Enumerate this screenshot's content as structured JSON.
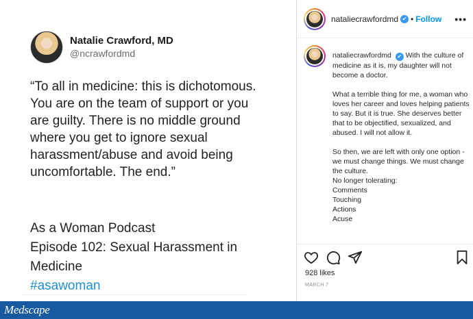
{
  "tweet_card": {
    "author_name": "Natalie Crawford, MD",
    "author_handle": "@ncrawfordmd",
    "quote": "“To all in medicine: this is dichotomous. You are on the team of support or you are guilty. There is no middle ground where you get to ignore sexual harassment/abuse and avoid being uncomfortable. The end.”",
    "podcast_line1": "As a Woman Podcast",
    "podcast_line2": "Episode 102: Sexual Harassment in Medicine",
    "hashtag": "#asawoman"
  },
  "instagram": {
    "header": {
      "username": "nataliecrawfordmd",
      "verified_icon": "✔",
      "separator": "•",
      "follow_label": "Follow",
      "more_label": "•••"
    },
    "caption": {
      "username": "nataliecrawfordmd",
      "verified_icon": "✔",
      "p1": "With the culture of medicine as it is, my daughter will not become a doctor.",
      "p2": "What a terrible thing for me, a woman who loves her career and loves helping patients to say. But it is true. She deserves better that to be objectified, sexualized, and abused. I will not allow it.",
      "p3": "So then, we are left with only one option - we must change things. We must change the culture.",
      "list_intro": "No longer tolerating:",
      "list": [
        "Comments",
        "Touching",
        "Actions",
        "Acuse"
      ]
    },
    "likes": "928 likes",
    "date": "MARCH 7",
    "icons": [
      "heart-icon",
      "comment-icon",
      "share-icon",
      "bookmark-icon"
    ]
  },
  "footer": {
    "brand": "Medscape",
    "background_color": "#16599e"
  }
}
